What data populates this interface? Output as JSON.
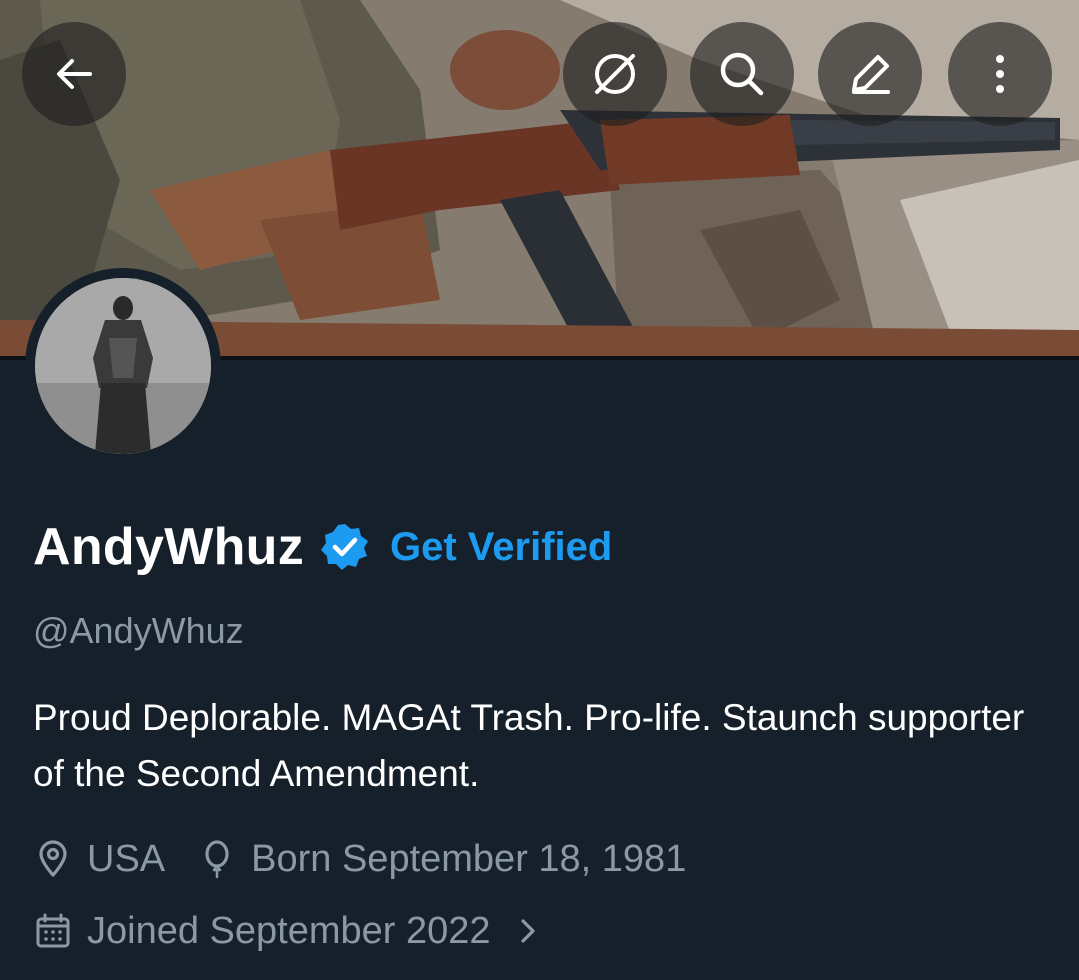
{
  "header": {
    "back_icon": "arrow-left-icon",
    "grok_icon": "grok-icon",
    "search_icon": "search-icon",
    "edit_icon": "pencil-icon",
    "more_icon": "more-vertical-icon"
  },
  "profile": {
    "display_name": "AndyWhuz",
    "verified_icon": "verified-badge-icon",
    "get_verified_label": "Get Verified",
    "handle": "@AndyWhuz",
    "bio": "Proud Deplorable. MAGAt Trash. Pro-life. Staunch supporter of the Second Amendment.",
    "location": "USA",
    "location_icon": "location-pin-icon",
    "birthday": "Born September 18, 1981",
    "birthday_icon": "balloon-icon",
    "joined": "Joined September 2022",
    "joined_icon": "calendar-icon",
    "chevron_icon": "chevron-right-icon"
  },
  "colors": {
    "background": "#15202b",
    "accent": "#1d9bf0",
    "secondary_text": "#8b98a5",
    "primary_text": "#ffffff"
  }
}
